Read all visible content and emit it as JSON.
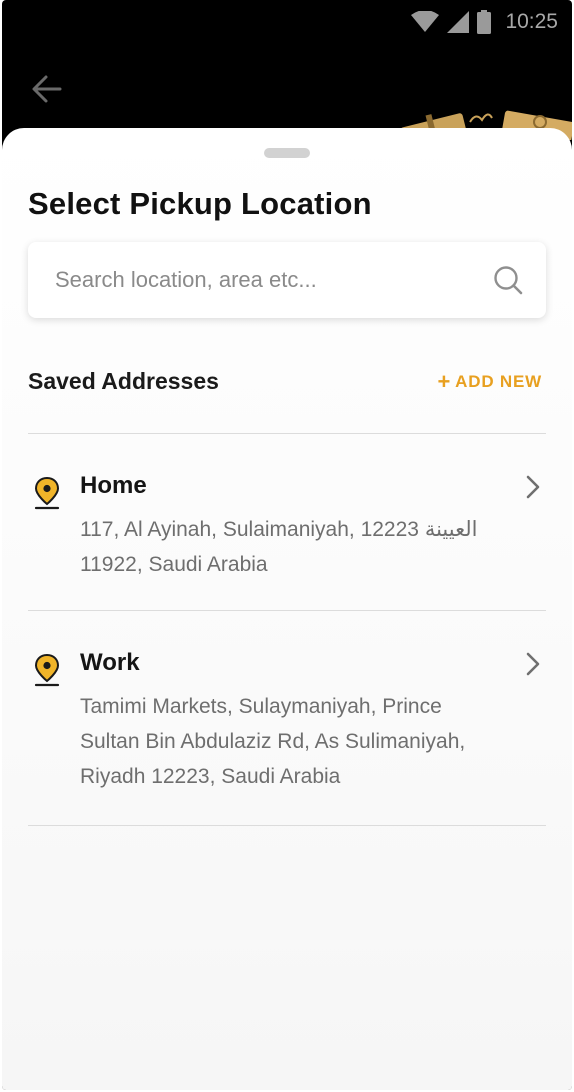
{
  "status_bar": {
    "time": "10:25"
  },
  "sheet": {
    "title": "Select Pickup Location",
    "search": {
      "placeholder": "Search location, area etc..."
    },
    "saved_addresses": {
      "title": "Saved Addresses",
      "add_new_label": "ADD NEW",
      "items": [
        {
          "name": "Home",
          "line1": "117, Al Ayinah, Sulaimaniyah, 12223 العيينة",
          "line2": "11922, Saudi Arabia"
        },
        {
          "name": "Work",
          "line1": "Tamimi Markets, Sulaymaniyah, Prince",
          "line2": "Sultan Bin Abdulaziz Rd, As Sulimaniyah,",
          "line3": "Riyadh 12223, Saudi Arabia"
        }
      ]
    }
  },
  "colors": {
    "accent": "#e8a020",
    "pin": "#f0b429"
  }
}
